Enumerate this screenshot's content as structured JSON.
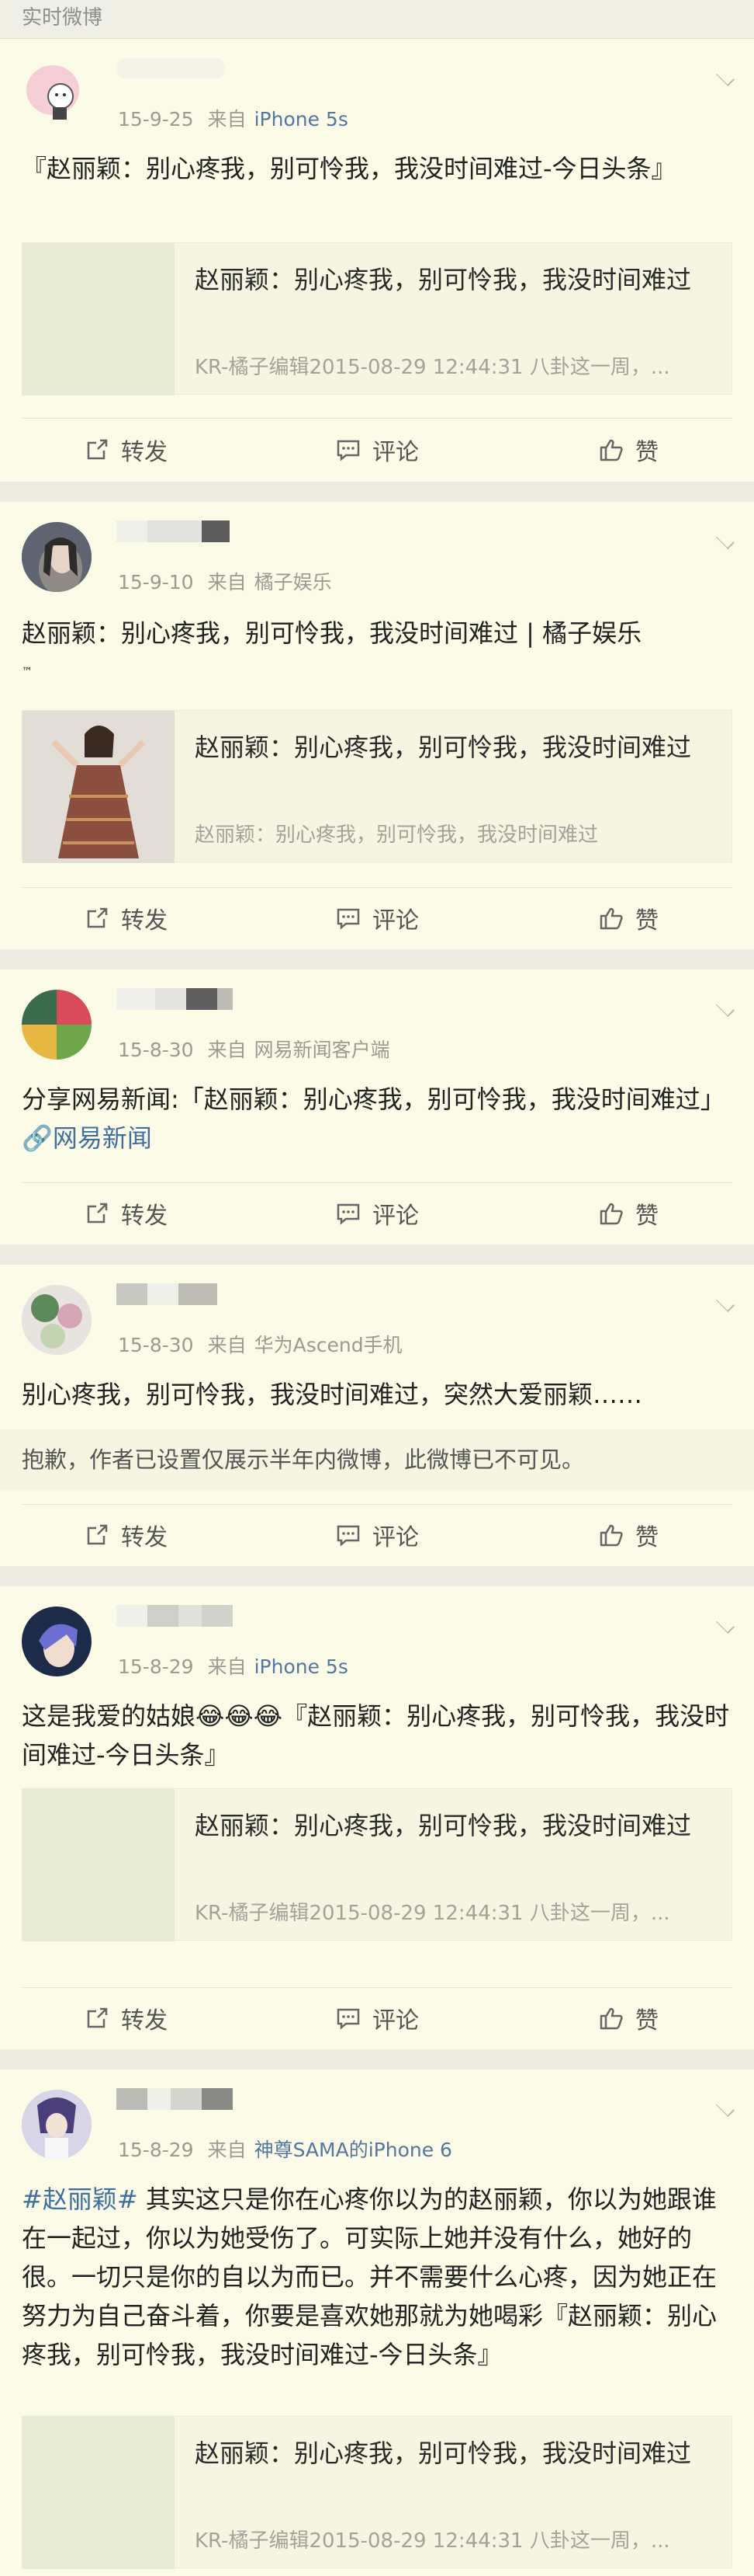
{
  "header": {
    "title": "实时微博"
  },
  "actions": {
    "repost": "转发",
    "comment": "评论",
    "like": "赞"
  },
  "posts": [
    {
      "time": "15-9-25",
      "from": "来自",
      "source": "iPhone 5s",
      "text": "『赵丽颖：别心疼我，别可怜我，我没时间难过-今日头条』",
      "embed": {
        "title": "赵丽颖：别心疼我，别可怜我，我没时间难过",
        "sub": "KR-橘子编辑2015-08-29 12:44:31 八卦这一周，..."
      }
    },
    {
      "time": "15-9-10",
      "from": "来自",
      "source": "橘子娱乐",
      "text": "赵丽颖：别心疼我，别可怜我，我没时间难过 | 橘子娱乐",
      "tm": "™",
      "embed": {
        "title": "赵丽颖：别心疼我，别可怜我，我没时间难过",
        "sub": "赵丽颖：别心疼我，别可怜我，我没时间难过"
      }
    },
    {
      "time": "15-8-30",
      "from": "来自",
      "source": "网易新闻客户端",
      "text": "分享网易新闻:「赵丽颖：别心疼我，别可怜我，我没时间难过」",
      "link": "🔗网易新闻"
    },
    {
      "time": "15-8-30",
      "from": "来自",
      "source": "华为Ascend手机",
      "text": "别心疼我，别可怜我，我没时间难过，突然大爱丽颖……",
      "notice": "抱歉，作者已设置仅展示半年内微博，此微博已不可见。"
    },
    {
      "time": "15-8-29",
      "from": "来自",
      "source": "iPhone 5s",
      "text": "这是我爱的姑娘😂😂😂『赵丽颖：别心疼我，别可怜我，我没时间难过-今日头条』",
      "embed": {
        "title": "赵丽颖：别心疼我，别可怜我，我没时间难过",
        "sub": "KR-橘子编辑2015-08-29 12:44:31 八卦这一周，..."
      }
    },
    {
      "time": "15-8-29",
      "from": "来自",
      "source": "神尊SAMA的iPhone 6",
      "hashtag": "#赵丽颖#",
      "text": " 其实这只是你在心疼你以为的赵丽颖，你以为她跟谁在一起过，你以为她受伤了。可实际上她并没有什么，她好的很。一切只是你的自以为而已。并不需要什么心疼，因为她正在努力为自己奋斗着，你要是喜欢她那就为她喝彩『赵丽颖：别心疼我，别可怜我，我没时间难过-今日头条』",
      "embed": {
        "title": "赵丽颖：别心疼我，别可怜我，我没时间难过",
        "sub": "KR-橘子编辑2015-08-29 12:44:31 八卦这一周，..."
      }
    }
  ]
}
